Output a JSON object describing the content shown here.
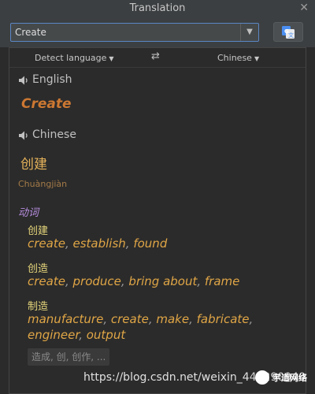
{
  "window": {
    "title": "Translation",
    "close_icon": "close-icon"
  },
  "toolbar": {
    "input_value": "Create",
    "dropdown_icon": "chevron-down-icon",
    "translate_button_icon": "google-translate-icon"
  },
  "lang_bar": {
    "source": "Detect language",
    "swap_icon": "swap-arrows-icon",
    "target": "Chinese"
  },
  "source": {
    "lang": "English",
    "word": "Create"
  },
  "target": {
    "lang": "Chinese",
    "word": "创建",
    "pinyin": "Chuàngjiàn"
  },
  "dictionary": {
    "pos": "动词",
    "entries": [
      {
        "meaning": "创建",
        "synonyms": [
          "create",
          "establish",
          "found"
        ]
      },
      {
        "meaning": "创造",
        "synonyms": [
          "create",
          "produce",
          "bring about",
          "frame"
        ]
      },
      {
        "meaning": "制造",
        "synonyms_line1": [
          "manufacture",
          "create",
          "make",
          "fabricate"
        ],
        "synonyms_line2": [
          "engineer",
          "output"
        ]
      }
    ],
    "more": "造成, 创, 创作, ..."
  },
  "watermark": {
    "url_text": "https://blog.csdn.net/weixin_4",
    "suffix": "40290940",
    "logo_text": "宇道网络"
  },
  "colors": {
    "accent": "#cc7832",
    "translation": "#e6b35a",
    "pos": "#b98ee0",
    "meaning": "#e4d47a",
    "synonym": "#e0a646"
  }
}
